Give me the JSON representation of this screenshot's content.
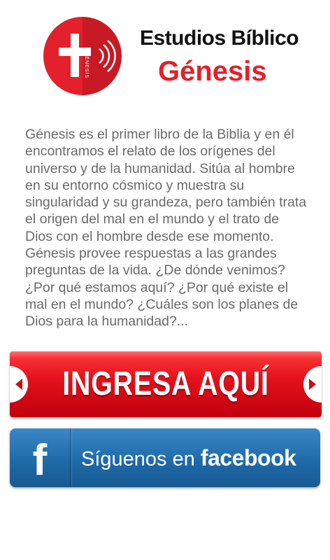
{
  "header": {
    "logo_vertical_text": "GÉNESIS",
    "title_line1": "Estudios Bíblico",
    "title_line2": "Génesis"
  },
  "description": "Génesis es el primer libro de la Biblia y en él encontramos el relato de los orígenes del universo y de la humanidad. Sitúa al hombre en su entorno cósmico y muestra su singularidad y su grandeza, pero también trata el origen del mal en el mundo y el trato de Dios con el hombre desde ese momento. Génesis provee respuestas a las grandes preguntas de la vida. ¿De dónde venimos? ¿Por qué estamos aquí? ¿Por qué existe el mal en el mundo? ¿Cuáles son los planes de Dios para la humanidad?...",
  "ingresa_button": {
    "label": "INGRESA AQUÍ",
    "color": "#e5121c"
  },
  "facebook_button": {
    "icon": "f",
    "label_prefix": "Síguenos en",
    "label_brand": "facebook",
    "color": "#1f6aa8"
  },
  "colors": {
    "brand_red": "#e3202b",
    "text_gray": "#6a6a6a"
  },
  "icons": [
    "cross-icon",
    "sound-waves-icon",
    "arrow-left-icon",
    "arrow-right-icon",
    "facebook-icon"
  ]
}
